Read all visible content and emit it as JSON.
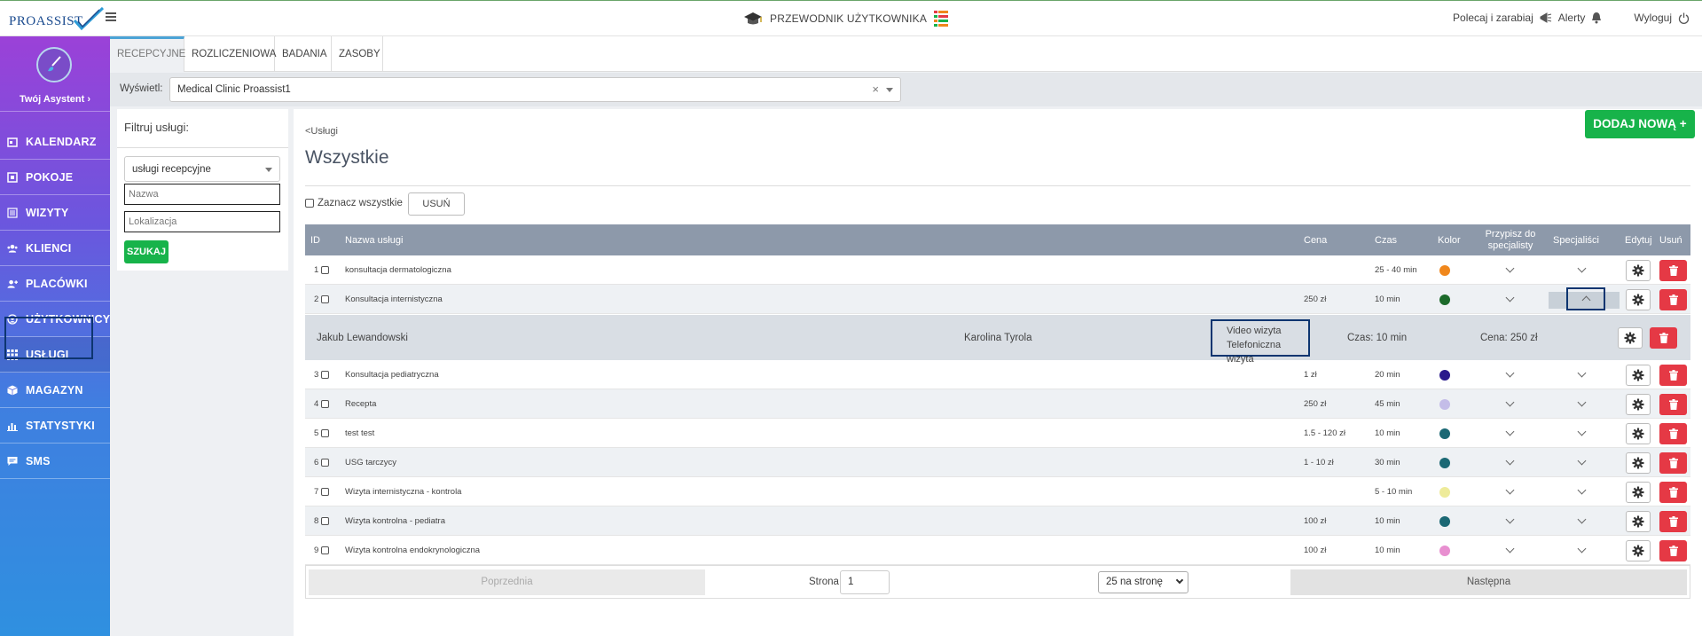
{
  "app": {
    "logo_text": "PROASSIST",
    "guide_label": "PRZEWODNIK UŻYTKOWNIKA",
    "refer_label": "Polecaj i zarabiaj",
    "alerts_label": "Alerty",
    "logout_label": "Wyloguj",
    "accent_color": "#17b34a",
    "danger_color": "#e53945"
  },
  "sidebar": {
    "assistant_label": "Twój Asystent ›",
    "items": [
      {
        "label": "KALENDARZ",
        "icon": "calendar-icon"
      },
      {
        "label": "POKOJE",
        "icon": "room-icon"
      },
      {
        "label": "WIZYTY",
        "icon": "list-icon"
      },
      {
        "label": "KLIENCI",
        "icon": "users-icon"
      },
      {
        "label": "PLACÓWKI",
        "icon": "user-plus-icon"
      },
      {
        "label": "UŻYTKOWNICY",
        "icon": "user-circle-icon"
      },
      {
        "label": "USŁUGI",
        "icon": "grid-icon",
        "active": true
      },
      {
        "label": "MAGAZYN",
        "icon": "box-icon"
      },
      {
        "label": "STATYSTYKI",
        "icon": "bar-chart-icon"
      },
      {
        "label": "SMS",
        "icon": "message-icon"
      }
    ]
  },
  "tabs": [
    "RECEPCYJNE",
    "ROZLICZENIOWA",
    "BADANIA",
    "ZASOBY"
  ],
  "display": {
    "label": "Wyświetl:",
    "value": "Medical Clinic Proassist1",
    "clear": "×"
  },
  "filter": {
    "title": "Filtruj usługi:",
    "type_value": "usługi recepcyjne",
    "name_placeholder": "Nazwa",
    "location_placeholder": "Lokalizacja",
    "search_label": "SZUKAJ"
  },
  "main": {
    "breadcrumb": "<Usługi",
    "title": "Wszystkie",
    "add_label": "DODAJ NOWĄ +",
    "select_all_label": "Zaznacz wszystkie",
    "delete_label": "USUŃ"
  },
  "table": {
    "headers": {
      "id": "ID",
      "name": "Nazwa usługi",
      "price": "Cena",
      "time": "Czas",
      "color": "Kolor",
      "assign_1": "Przypisz do",
      "assign_2": "specjalisty",
      "specialists": "Specjaliści",
      "edit": "Edytuj",
      "delete": "Usuń"
    },
    "rows": [
      {
        "id": "1",
        "name": "konsultacja dermatologiczna",
        "price": "",
        "time": "25 - 40 min",
        "color": "#f0871c"
      },
      {
        "id": "2",
        "name": "Konsultacja internistyczna",
        "price": "250 zł",
        "time": "10 min",
        "color": "#1c6a2a",
        "expanded": true
      },
      {
        "id": "3",
        "name": "Konsultacja pediatryczna",
        "price": "1 zł",
        "time": "20 min",
        "color": "#2a1a8c"
      },
      {
        "id": "4",
        "name": "Recepta",
        "price": "250 zł",
        "time": "45 min",
        "color": "#c4bde8"
      },
      {
        "id": "5",
        "name": "test test",
        "price": "1.5 - 120 zł",
        "time": "10 min",
        "color": "#1b6874"
      },
      {
        "id": "6",
        "name": "USG tarczycy",
        "price": "1 - 10 zł",
        "time": "30 min",
        "color": "#1b6874"
      },
      {
        "id": "7",
        "name": "Wizyta internistyczna - kontrola",
        "price": "",
        "time": "5 - 10 min",
        "color": "#eeeb9a"
      },
      {
        "id": "8",
        "name": "Wizyta kontrolna - pediatra",
        "price": "100 zł",
        "time": "10 min",
        "color": "#1b6874"
      },
      {
        "id": "9",
        "name": "Wizyta kontrolna endokrynologiczna",
        "price": "100 zł",
        "time": "10 min",
        "color": "#e88fd0"
      }
    ],
    "sub_row": {
      "specialist": "Jakub Lewandowski",
      "assistant": "Karolina Tyrola",
      "type_1": "Video wizyta",
      "type_2": "Telefoniczna wizyta",
      "time": "Czas: 10 min",
      "price": "Cena: 250 zł"
    }
  },
  "pagination": {
    "prev_label": "Poprzednia",
    "page_label": "Strona",
    "page_value": "1",
    "page_size": "25 na stronę",
    "next_label": "Następna"
  }
}
